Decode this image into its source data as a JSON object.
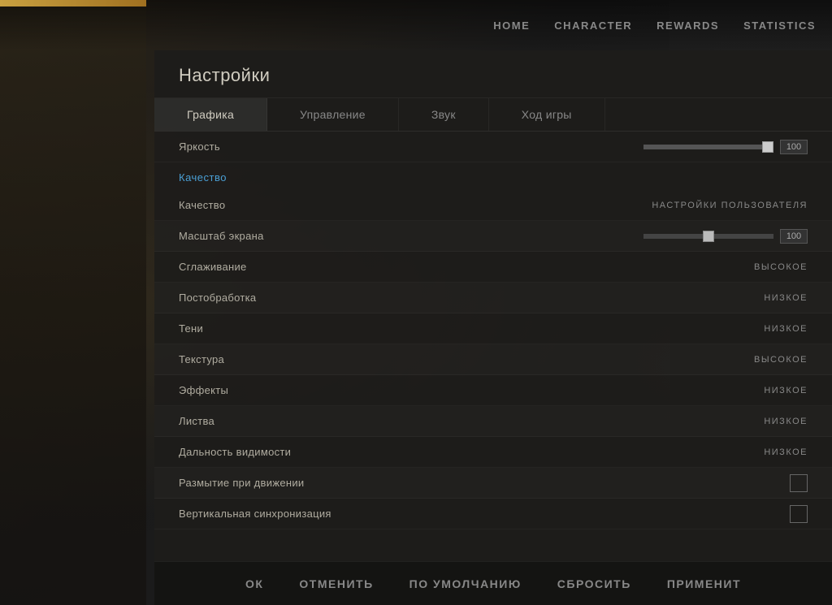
{
  "nav": {
    "items": [
      {
        "id": "home",
        "label": "HOME",
        "active": false
      },
      {
        "id": "character",
        "label": "CHARACTER",
        "active": false
      },
      {
        "id": "rewards",
        "label": "REWARDS",
        "active": false
      },
      {
        "id": "statistics",
        "label": "STATISTICS",
        "active": false
      }
    ]
  },
  "settings": {
    "title": "Настройки",
    "tabs": [
      {
        "id": "graphics",
        "label": "Графика",
        "active": true
      },
      {
        "id": "controls",
        "label": "Управление",
        "active": false
      },
      {
        "id": "sound",
        "label": "Звук",
        "active": false
      },
      {
        "id": "gameplay",
        "label": "Ход игры",
        "active": false
      }
    ],
    "brightness": {
      "label": "Яркость",
      "value": "100"
    },
    "quality_section": {
      "header": "Качество",
      "rows": [
        {
          "id": "quality",
          "label": "Качество",
          "value": "НАСТРОЙКИ ПОЛЬЗОВАТЕЛЯ",
          "type": "text"
        },
        {
          "id": "scale",
          "label": "Масштаб экрана",
          "value": "100",
          "type": "slider"
        },
        {
          "id": "aa",
          "label": "Сглаживание",
          "value": "ВЫСОКОЕ",
          "type": "text"
        },
        {
          "id": "postprocess",
          "label": "Постобработка",
          "value": "НИЗКОЕ",
          "type": "text"
        },
        {
          "id": "shadows",
          "label": "Тени",
          "value": "НИЗКОЕ",
          "type": "text"
        },
        {
          "id": "texture",
          "label": "Текстура",
          "value": "ВЫСОКОЕ",
          "type": "text"
        },
        {
          "id": "effects",
          "label": "Эффекты",
          "value": "НИЗКОЕ",
          "type": "text"
        },
        {
          "id": "foliage",
          "label": "Листва",
          "value": "НИЗКОЕ",
          "type": "text"
        },
        {
          "id": "visibility",
          "label": "Дальность видимости",
          "value": "НИЗКОЕ",
          "type": "text"
        },
        {
          "id": "motion_blur",
          "label": "Размытие при движении",
          "value": "",
          "type": "checkbox"
        },
        {
          "id": "vsync",
          "label": "Вертикальная синхронизация",
          "value": "",
          "type": "checkbox"
        }
      ]
    }
  },
  "bottom_actions": [
    {
      "id": "ok",
      "label": "ОК"
    },
    {
      "id": "cancel",
      "label": "ОТМЕНИТЬ"
    },
    {
      "id": "default",
      "label": "ПО УМОЛЧАНИЮ"
    },
    {
      "id": "reset",
      "label": "СБРОСИТЬ"
    },
    {
      "id": "apply",
      "label": "ПРИМЕНИТ"
    }
  ]
}
